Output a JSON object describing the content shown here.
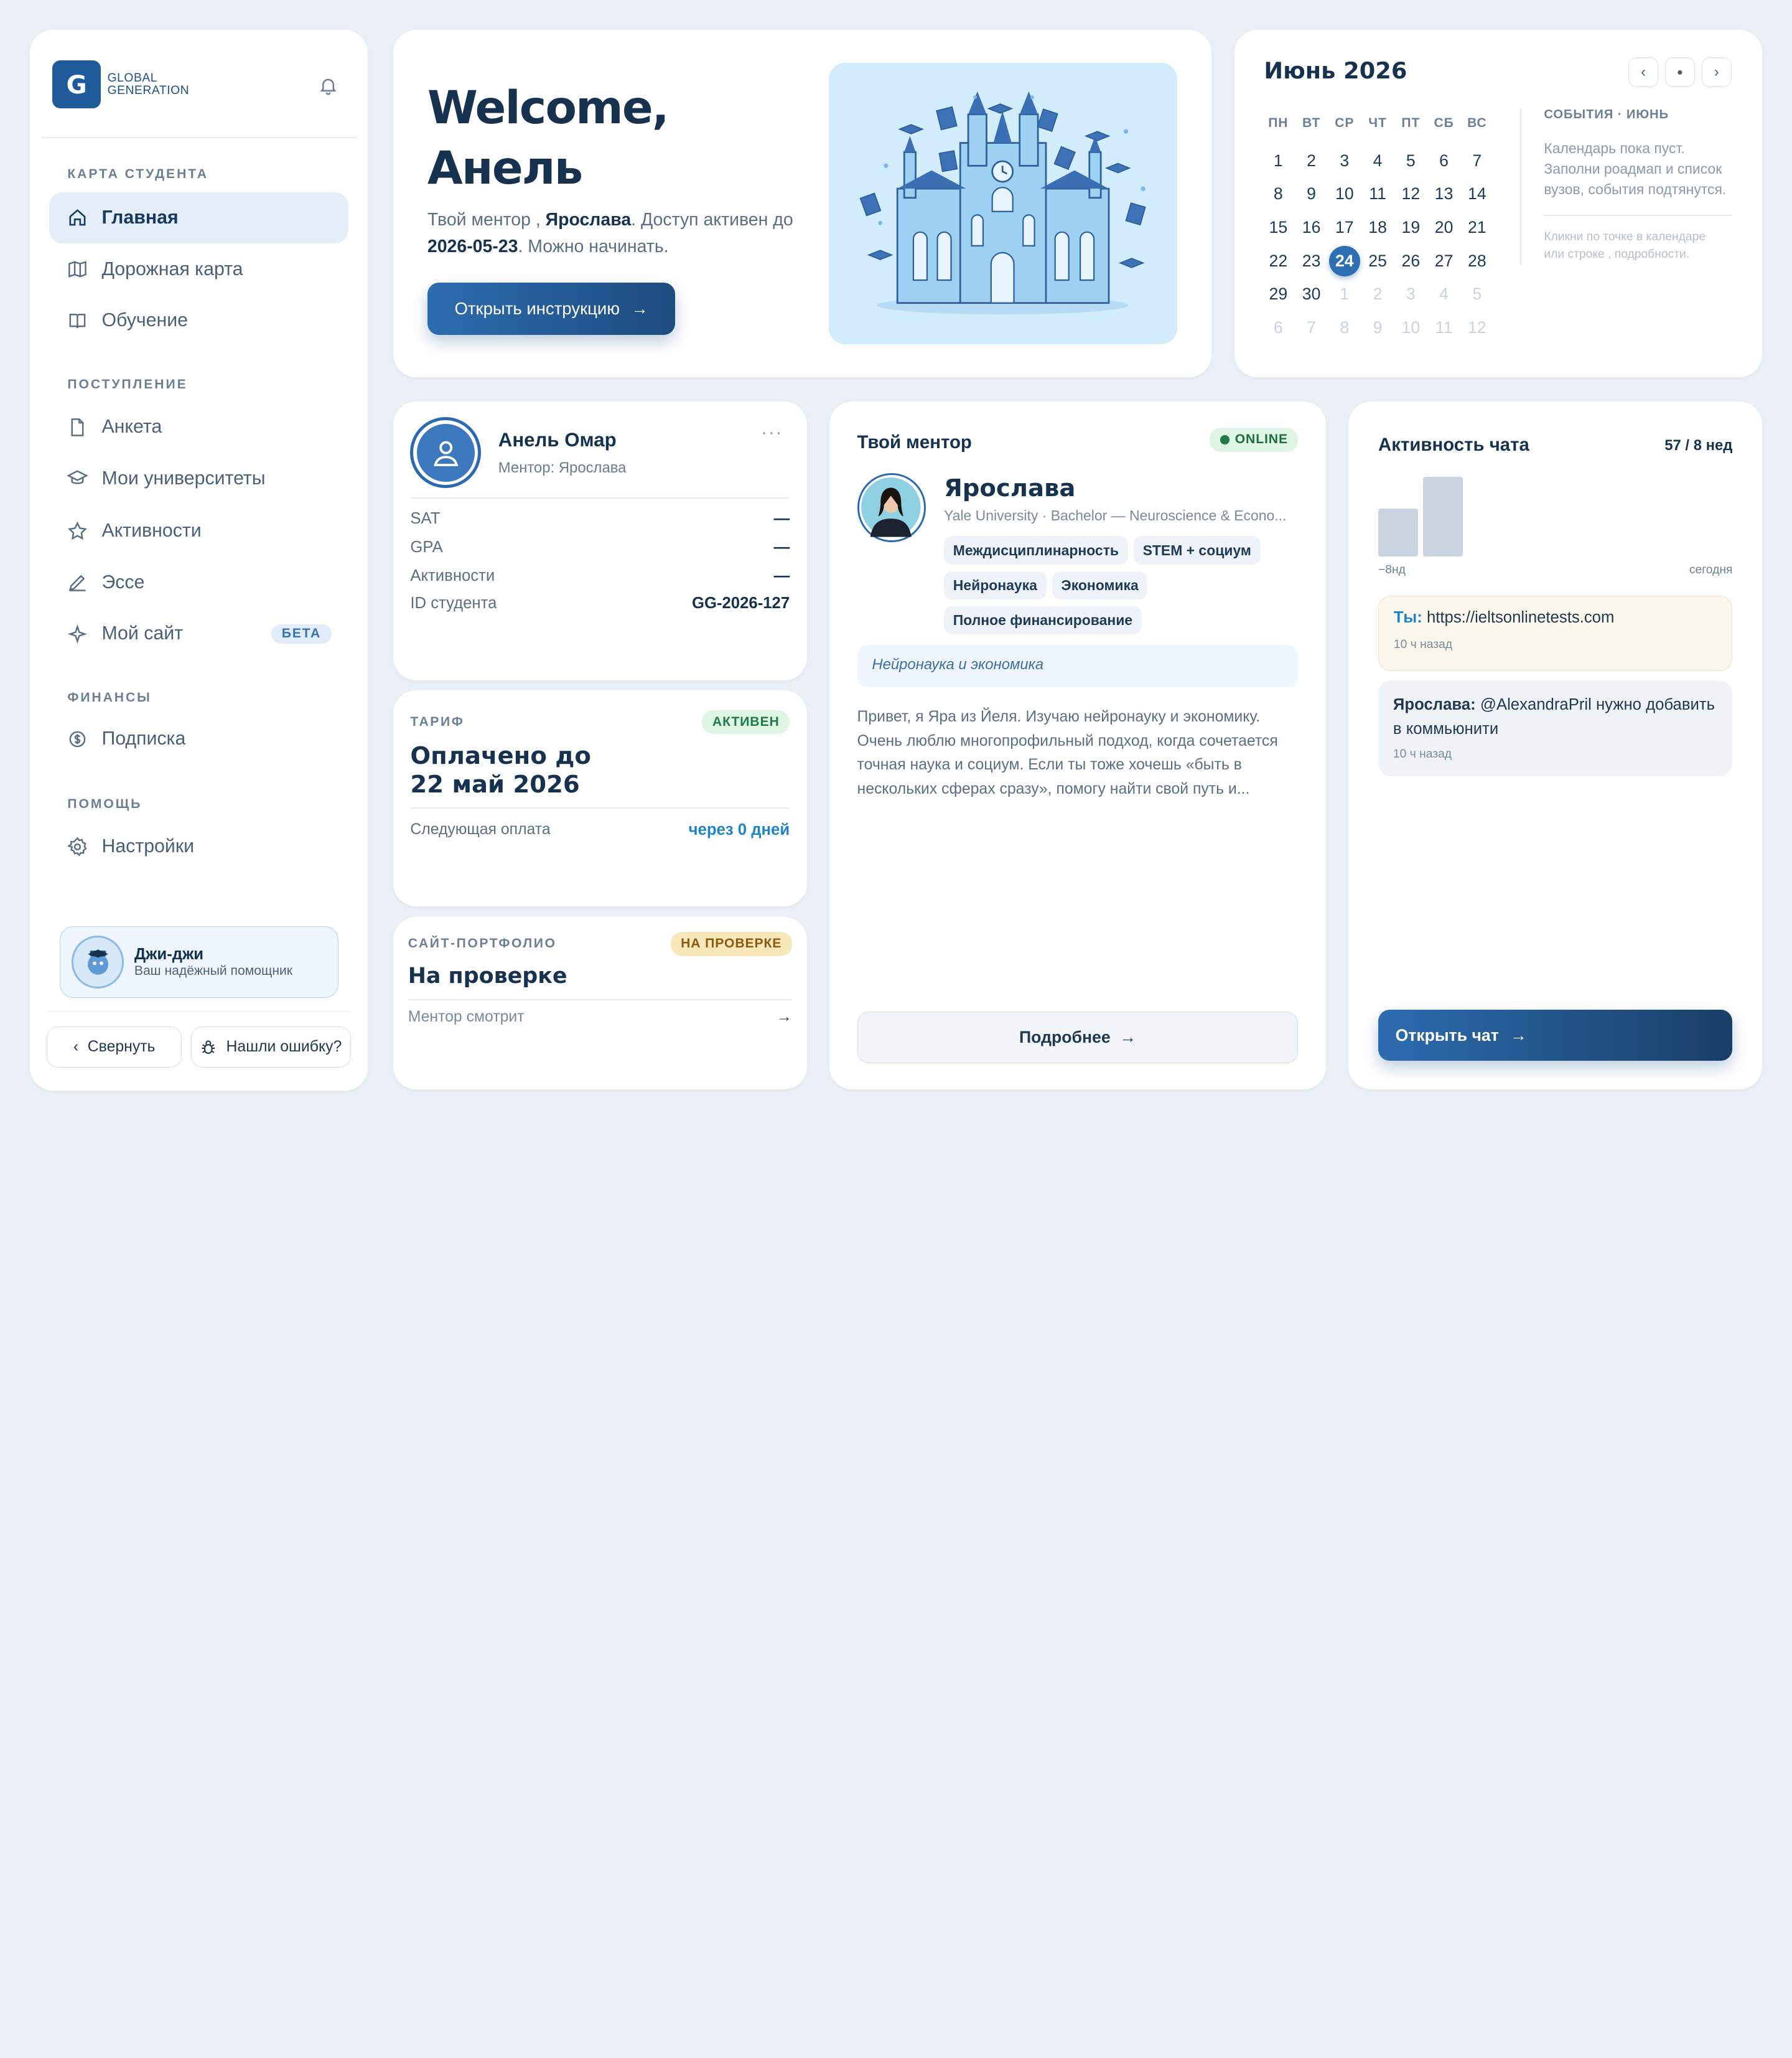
{
  "brand": {
    "mark": "G",
    "line1": "GLOBAL",
    "line2": "GENERATION"
  },
  "sidebar": {
    "sections": [
      "КАРТА СТУДЕНТА",
      "ПОСТУПЛЕНИЕ",
      "ФИНАНСЫ",
      "ПОМОЩЬ"
    ],
    "items": [
      {
        "label": "Главная",
        "icon": "home-icon",
        "active": true
      },
      {
        "label": "Дорожная карта",
        "icon": "map-icon"
      },
      {
        "label": "Обучение",
        "icon": "book-icon"
      },
      {
        "label": "Анкета",
        "icon": "document-icon"
      },
      {
        "label": "Мои университеты",
        "icon": "graduation-cap-icon"
      },
      {
        "label": "Активности",
        "icon": "star-icon"
      },
      {
        "label": "Эссе",
        "icon": "pen-icon"
      },
      {
        "label": "Мой сайт",
        "icon": "sparkle-icon",
        "badge": "БЕТА"
      },
      {
        "label": "Подписка",
        "icon": "coin-icon"
      },
      {
        "label": "Настройки",
        "icon": "gear-icon"
      }
    ],
    "assistant": {
      "name": "Джи-джи",
      "subtitle": "Ваш надёжный помощник"
    },
    "collapse_label": "Свернуть",
    "bug_label": "Нашли ошибку?"
  },
  "welcome": {
    "title_line1": "Welcome,",
    "title_line2": "Анель",
    "text_pre": "Твой ментор , ",
    "mentor": "Ярослава",
    "text_mid": ". Доступ активен до ",
    "date": "2026-05-23",
    "text_post": ". Можно начинать.",
    "button": "Открыть инструкцию"
  },
  "calendar": {
    "title": "Июнь 2026",
    "weekdays": [
      "ПН",
      "ВТ",
      "СР",
      "ЧТ",
      "ПТ",
      "СБ",
      "ВС"
    ],
    "days": [
      1,
      2,
      3,
      4,
      5,
      6,
      7,
      8,
      9,
      10,
      11,
      12,
      13,
      14,
      15,
      16,
      17,
      18,
      19,
      20,
      21,
      22,
      23,
      24,
      25,
      26,
      27,
      28,
      29,
      30
    ],
    "next_days": [
      1,
      2,
      3,
      4,
      5,
      6,
      7,
      8,
      9,
      10,
      11,
      12
    ],
    "today": 24,
    "events_title": "СОБЫТИЯ · ИЮНЬ",
    "empty_text": "Календарь пока пуст. Заполни роадмап и список вузов, события подтянутся.",
    "hint": "Кликни по точке в календаре или строке , подробности."
  },
  "profile": {
    "name": "Анель Омар",
    "mentor_line": "Ментор: Ярослава",
    "rows": [
      {
        "label": "SAT",
        "value": "—"
      },
      {
        "label": "GPA",
        "value": "—"
      },
      {
        "label": "Активности",
        "value": "—"
      },
      {
        "label": "ID студента",
        "value": "GG-2026-127"
      }
    ]
  },
  "tariff": {
    "label": "ТАРИФ",
    "badge": "АКТИВЕН",
    "line1": "Оплачено до",
    "line2": "22 май 2026",
    "next_label": "Следующая оплата",
    "next_value": "через 0 дней"
  },
  "portfolio": {
    "label": "САЙТ-ПОРТФОЛИО",
    "badge": "НА ПРОВЕРКЕ",
    "title": "На проверке",
    "sub": "Ментор смотрит"
  },
  "mentor": {
    "heading": "Твой ментор",
    "status": "ONLINE",
    "name": "Ярослава",
    "school": "Yale University · Bachelor — Neuroscience & Econo...",
    "tags": [
      "Междисциплинарность",
      "STEM + социум",
      "Нейронаука",
      "Экономика",
      "Полное финансирование"
    ],
    "focus": "Нейронаука и экономика",
    "bio": "Привет, я Яра из Йеля. Изучаю нейронауку и экономику. Очень люблю многопрофильный подход, когда сочетается точная наука и социум. Если ты тоже хочешь «быть в нескольких сферах сразу», помогу найти свой путь и...",
    "button": "Подробнее"
  },
  "chat": {
    "title": "Активность чата",
    "stat": "57 / 8 нед",
    "bars": [
      42,
      70
    ],
    "axis_left": "−8нд",
    "axis_right": "сегодня",
    "messages": [
      {
        "author": "Ты:",
        "text": "https://ieltsonlinetests.com",
        "time": "10 ч назад"
      },
      {
        "author": "Ярослава:",
        "text": "@AlexandraPril нужно добавить в коммьюнити",
        "time": "10 ч назад"
      }
    ],
    "button": "Открыть чат"
  },
  "colors": {
    "accent": "#2e6fb4",
    "navy": "#16324f",
    "online": "#1f8a4c",
    "warning": "#f8e7b8"
  }
}
